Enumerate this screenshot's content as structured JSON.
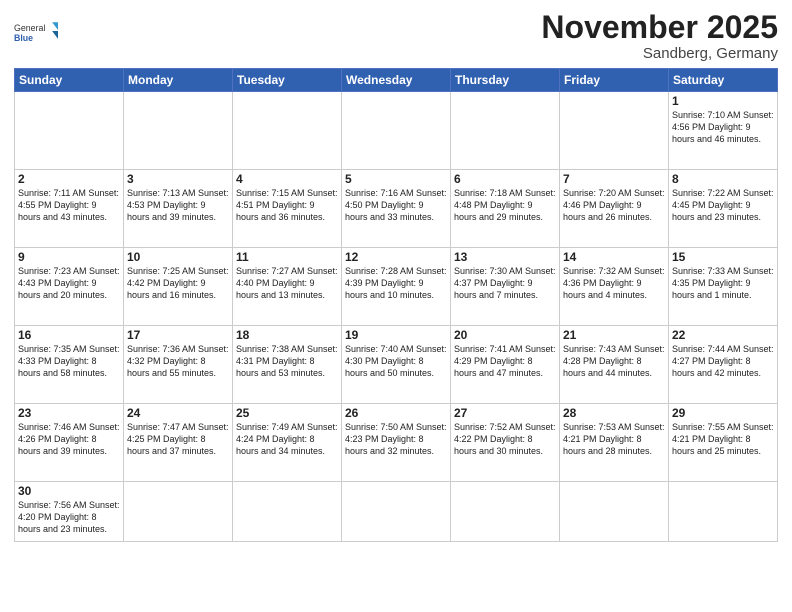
{
  "header": {
    "logo": {
      "text_normal": "General",
      "text_bold": "Blue"
    },
    "month": "November 2025",
    "location": "Sandberg, Germany"
  },
  "weekdays": [
    "Sunday",
    "Monday",
    "Tuesday",
    "Wednesday",
    "Thursday",
    "Friday",
    "Saturday"
  ],
  "weeks": [
    [
      {
        "day": "",
        "info": ""
      },
      {
        "day": "",
        "info": ""
      },
      {
        "day": "",
        "info": ""
      },
      {
        "day": "",
        "info": ""
      },
      {
        "day": "",
        "info": ""
      },
      {
        "day": "",
        "info": ""
      },
      {
        "day": "1",
        "info": "Sunrise: 7:10 AM\nSunset: 4:56 PM\nDaylight: 9 hours and 46 minutes."
      }
    ],
    [
      {
        "day": "2",
        "info": "Sunrise: 7:11 AM\nSunset: 4:55 PM\nDaylight: 9 hours and 43 minutes."
      },
      {
        "day": "3",
        "info": "Sunrise: 7:13 AM\nSunset: 4:53 PM\nDaylight: 9 hours and 39 minutes."
      },
      {
        "day": "4",
        "info": "Sunrise: 7:15 AM\nSunset: 4:51 PM\nDaylight: 9 hours and 36 minutes."
      },
      {
        "day": "5",
        "info": "Sunrise: 7:16 AM\nSunset: 4:50 PM\nDaylight: 9 hours and 33 minutes."
      },
      {
        "day": "6",
        "info": "Sunrise: 7:18 AM\nSunset: 4:48 PM\nDaylight: 9 hours and 29 minutes."
      },
      {
        "day": "7",
        "info": "Sunrise: 7:20 AM\nSunset: 4:46 PM\nDaylight: 9 hours and 26 minutes."
      },
      {
        "day": "8",
        "info": "Sunrise: 7:22 AM\nSunset: 4:45 PM\nDaylight: 9 hours and 23 minutes."
      }
    ],
    [
      {
        "day": "9",
        "info": "Sunrise: 7:23 AM\nSunset: 4:43 PM\nDaylight: 9 hours and 20 minutes."
      },
      {
        "day": "10",
        "info": "Sunrise: 7:25 AM\nSunset: 4:42 PM\nDaylight: 9 hours and 16 minutes."
      },
      {
        "day": "11",
        "info": "Sunrise: 7:27 AM\nSunset: 4:40 PM\nDaylight: 9 hours and 13 minutes."
      },
      {
        "day": "12",
        "info": "Sunrise: 7:28 AM\nSunset: 4:39 PM\nDaylight: 9 hours and 10 minutes."
      },
      {
        "day": "13",
        "info": "Sunrise: 7:30 AM\nSunset: 4:37 PM\nDaylight: 9 hours and 7 minutes."
      },
      {
        "day": "14",
        "info": "Sunrise: 7:32 AM\nSunset: 4:36 PM\nDaylight: 9 hours and 4 minutes."
      },
      {
        "day": "15",
        "info": "Sunrise: 7:33 AM\nSunset: 4:35 PM\nDaylight: 9 hours and 1 minute."
      }
    ],
    [
      {
        "day": "16",
        "info": "Sunrise: 7:35 AM\nSunset: 4:33 PM\nDaylight: 8 hours and 58 minutes."
      },
      {
        "day": "17",
        "info": "Sunrise: 7:36 AM\nSunset: 4:32 PM\nDaylight: 8 hours and 55 minutes."
      },
      {
        "day": "18",
        "info": "Sunrise: 7:38 AM\nSunset: 4:31 PM\nDaylight: 8 hours and 53 minutes."
      },
      {
        "day": "19",
        "info": "Sunrise: 7:40 AM\nSunset: 4:30 PM\nDaylight: 8 hours and 50 minutes."
      },
      {
        "day": "20",
        "info": "Sunrise: 7:41 AM\nSunset: 4:29 PM\nDaylight: 8 hours and 47 minutes."
      },
      {
        "day": "21",
        "info": "Sunrise: 7:43 AM\nSunset: 4:28 PM\nDaylight: 8 hours and 44 minutes."
      },
      {
        "day": "22",
        "info": "Sunrise: 7:44 AM\nSunset: 4:27 PM\nDaylight: 8 hours and 42 minutes."
      }
    ],
    [
      {
        "day": "23",
        "info": "Sunrise: 7:46 AM\nSunset: 4:26 PM\nDaylight: 8 hours and 39 minutes."
      },
      {
        "day": "24",
        "info": "Sunrise: 7:47 AM\nSunset: 4:25 PM\nDaylight: 8 hours and 37 minutes."
      },
      {
        "day": "25",
        "info": "Sunrise: 7:49 AM\nSunset: 4:24 PM\nDaylight: 8 hours and 34 minutes."
      },
      {
        "day": "26",
        "info": "Sunrise: 7:50 AM\nSunset: 4:23 PM\nDaylight: 8 hours and 32 minutes."
      },
      {
        "day": "27",
        "info": "Sunrise: 7:52 AM\nSunset: 4:22 PM\nDaylight: 8 hours and 30 minutes."
      },
      {
        "day": "28",
        "info": "Sunrise: 7:53 AM\nSunset: 4:21 PM\nDaylight: 8 hours and 28 minutes."
      },
      {
        "day": "29",
        "info": "Sunrise: 7:55 AM\nSunset: 4:21 PM\nDaylight: 8 hours and 25 minutes."
      }
    ],
    [
      {
        "day": "30",
        "info": "Sunrise: 7:56 AM\nSunset: 4:20 PM\nDaylight: 8 hours and 23 minutes."
      },
      {
        "day": "",
        "info": ""
      },
      {
        "day": "",
        "info": ""
      },
      {
        "day": "",
        "info": ""
      },
      {
        "day": "",
        "info": ""
      },
      {
        "day": "",
        "info": ""
      },
      {
        "day": "",
        "info": ""
      }
    ]
  ],
  "colors": {
    "header_bg": "#2e5fad",
    "header_text": "#ffffff",
    "border": "#cccccc"
  }
}
